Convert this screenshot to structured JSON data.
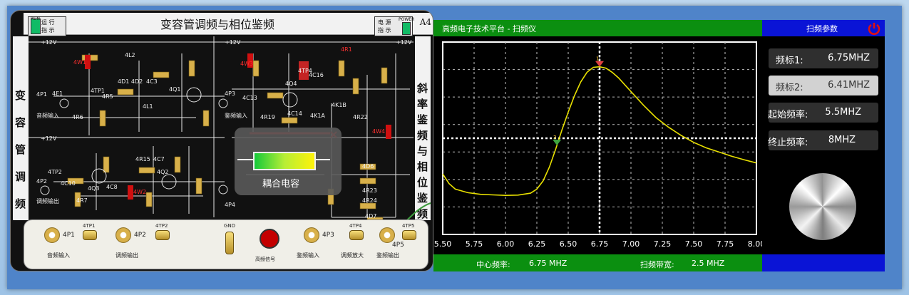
{
  "board": {
    "title": "变容管调频与相位鉴频",
    "page_tag": "A4",
    "run_indicator": {
      "top": "RUN",
      "l1": "运 行",
      "l2": "指 示"
    },
    "power_indicator": {
      "l1": "电 源",
      "l2": "指 示",
      "tag": "POWER"
    },
    "left_side": [
      "变",
      "容",
      "管",
      "调",
      "频"
    ],
    "right_side": [
      "斜",
      "率",
      "鉴",
      "频",
      "与",
      "相",
      "位",
      "鉴",
      "频"
    ],
    "component_labels": {
      "r_4w1": "4W1",
      "r_4w3": "4W3",
      "r_4w2": "4W2",
      "r_4w4": "4W4",
      "c_4l2": "4L2",
      "c_4l1": "4L1",
      "c_4d1": "4D1 4D2",
      "c_4c3": "4C3",
      "c_4q1": "4Q1",
      "c_4r5": "4R5",
      "c_4e1": "4E1",
      "c_4tp1": "4TP1",
      "c_4p1": "4P1",
      "c_4r6": "4R6",
      "c_4p3": "4P3",
      "c_4c13": "4C13",
      "c_4q4": "4Q4",
      "c_4r19": "4R19",
      "c_4c14": "4C14",
      "c_4tp4": "4TP4",
      "c_4r1": "4R1",
      "c_4c16": "4C16",
      "c_4k1b": "4K1B",
      "c_4k1a": "4K1A",
      "c_4r15": "4R15",
      "c_4c7": "4C7",
      "c_4q2": "4Q2",
      "c_4c8": "4C8",
      "c_4q3": "4Q3",
      "c_4tp2": "4TP2",
      "c_4p2": "4P2",
      "c_4c10": "4C10",
      "c_4r7": "4R7",
      "c_4d6": "4D6",
      "c_4r23": "4R23",
      "c_4r24": "4R24",
      "c_4d7": "4D7",
      "c_4r22": "4R22",
      "c_4p4": "4P4",
      "vplus1": "+12V",
      "vplus2": "+12V",
      "vplus3": "+12V",
      "vplus4": "+12V",
      "in_audio": "音频输入",
      "out_mod": "调频输出",
      "in_disc": "鉴频输入"
    },
    "tooltip_label": "耦合电容",
    "bottom_jacks": [
      {
        "id": "4P1",
        "tp": "4TP1",
        "label": "音频输入"
      },
      {
        "id": "4P2",
        "tp": "4TP2",
        "label": "调频输出"
      },
      {
        "id": "4P3",
        "tp": "",
        "label": "鉴频输入"
      },
      {
        "id": "4P5",
        "tp": "4TP5",
        "label": "鉴频输出"
      }
    ],
    "gnd_label": "GND",
    "tp4_label": "4TP4",
    "amp_label": "调频放大",
    "hf_label": "高频信号"
  },
  "scope": {
    "title": "高频电子技术平台 - 扫频仪",
    "center_freq_label": "中心频率:",
    "center_freq_value": "6.75 MHZ",
    "bandwidth_label": "扫频带宽:",
    "bandwidth_value": "2.5 MHZ",
    "trace_color": "#e8e000",
    "marker1_color": "#e04040",
    "marker2_color": "#3fa53f"
  },
  "chart_data": {
    "type": "line",
    "title": "",
    "xlabel": "",
    "ylabel": "",
    "xlim": [
      5.5,
      8.0
    ],
    "ylim": [
      0,
      7
    ],
    "x_ticks": [
      "5.50",
      "5.75",
      "6.00",
      "6.25",
      "6.50",
      "6.75",
      "7.00",
      "7.25",
      "7.50",
      "7.75",
      "8.00"
    ],
    "grid": true,
    "series": [
      {
        "x": [
          5.5,
          5.55,
          5.6,
          5.7,
          5.8,
          5.9,
          6.0,
          6.1,
          6.2,
          6.25,
          6.3,
          6.35,
          6.4,
          6.45,
          6.5,
          6.55,
          6.6,
          6.65,
          6.7,
          6.75,
          6.8,
          6.85,
          6.9,
          6.95,
          7.0,
          7.1,
          7.2,
          7.3,
          7.4,
          7.5,
          7.6,
          7.7,
          7.8,
          7.9,
          8.0
        ],
        "y": [
          2.2,
          1.85,
          1.65,
          1.52,
          1.46,
          1.44,
          1.42,
          1.43,
          1.5,
          1.65,
          1.95,
          2.45,
          3.1,
          3.8,
          4.45,
          5.05,
          5.55,
          5.9,
          6.08,
          6.1,
          6.05,
          5.9,
          5.7,
          5.45,
          5.2,
          4.7,
          4.25,
          3.9,
          3.6,
          3.35,
          3.15,
          3.0,
          2.85,
          2.72,
          2.6
        ]
      }
    ],
    "markers": [
      {
        "name": "标1",
        "x": 6.75,
        "color": "#e04040"
      },
      {
        "name": "标2",
        "x": 6.41,
        "color": "#3fa53f"
      }
    ]
  },
  "params": {
    "header": "扫频参数",
    "rows": [
      {
        "label": "频标1:",
        "value": "6.75MHZ",
        "style": "dark"
      },
      {
        "label": "频标2:",
        "value": "6.41MHZ",
        "style": "light"
      },
      {
        "label": "起始频率:",
        "value": "5.5MHZ",
        "style": "dark"
      },
      {
        "label": "终止频率:",
        "value": "8MHZ",
        "style": "dark"
      }
    ],
    "power_color": "#e01010"
  }
}
